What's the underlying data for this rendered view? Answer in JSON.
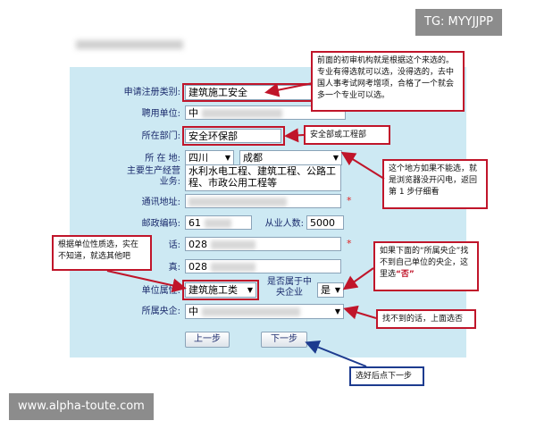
{
  "tag_label": "TG: MYYJJPP",
  "watermark": "www.alpha-toute.com",
  "form": {
    "category_label": "申请注册类别:",
    "category_value": "建筑施工安全",
    "employer_label": "聘用单位:",
    "employer_value_prefix": "中",
    "department_label": "所在部门:",
    "department_value": "安全环保部",
    "location_label": "所 在 地:",
    "province_value": "四川",
    "city_value": "成都",
    "business_label": "主要生产经营业务:",
    "business_value": "水利水电工程、建筑工程、公路工程、市政公用工程等",
    "address_label": "通讯地址:",
    "postcode_label": "邮政编码:",
    "postcode_prefix": "61",
    "employees_label": "从业人数:",
    "employees_value": "5000",
    "phone_label_suffix": "话:",
    "phone_prefix": "028",
    "fax_label_suffix": "真:",
    "fax_prefix": "028",
    "unit_type_label": "单位属性:",
    "unit_type_value": "建筑施工类",
    "central_label": "是否属于中央企业",
    "central_value": "是",
    "central_org_label": "所属央企:",
    "central_org_prefix": "中",
    "required_mark": "*",
    "prev_button": "上一步",
    "next_button": "下一步"
  },
  "callouts": {
    "top": "前面的初审机构就是根据这个来选的。专业有得选就可以选，没得选的，去中国人事考试网考增项，合格了一个就会多一个专业可以选。",
    "department": "安全部或工程部",
    "browser": "这个地方如果不能选，就是浏览器没开闪电，返回第 1 步仔细看",
    "unit_type": "根据单位性质选，实在不知道，就选其他吧",
    "central_a": "如果下面的“所属央企”找不到自己单位的央企，这里选",
    "central_b": "“否”",
    "cannot_find": "找不到的话，上面选否",
    "next_hint": "选好后点下一步"
  },
  "colors": {
    "panel": "#cde9f3",
    "callout_border": "#c0152a",
    "hint_border": "#1d3b8f",
    "label_text": "#1a2a6c"
  }
}
